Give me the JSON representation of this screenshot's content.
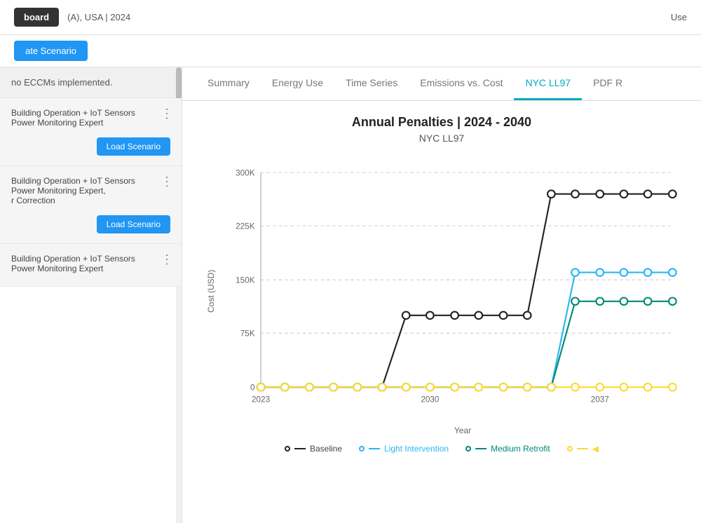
{
  "header": {
    "dashboard_label": "board",
    "location": "(A), USA | 2024",
    "right_text": "Use"
  },
  "sub_header": {
    "create_scenario_btn": "ate Scenario"
  },
  "sidebar": {
    "no_eccm_text": "no ECCMs implemented.",
    "scenarios": [
      {
        "id": 1,
        "title": "Building Operation + IoT Sensors\nPower Monitoring Expert",
        "load_btn": "Load Scenario"
      },
      {
        "id": 2,
        "title": "Building Operation + IoT Sensors\nPower Monitoring Expert,\nr Correction",
        "load_btn": "Load Scenario"
      },
      {
        "id": 3,
        "title": "Building Operation + IoT Sensors\nPower Monitoring Expert",
        "load_btn": "Load Scenario"
      }
    ]
  },
  "tabs": [
    {
      "label": "Summary",
      "active": false
    },
    {
      "label": "Energy Use",
      "active": false
    },
    {
      "label": "Time Series",
      "active": false
    },
    {
      "label": "Emissions vs. Cost",
      "active": false
    },
    {
      "label": "NYC LL97",
      "active": true
    },
    {
      "label": "PDF R",
      "active": false
    }
  ],
  "chart": {
    "title": "Annual Penalties | 2024 - 2040",
    "subtitle": "NYC LL97",
    "y_axis_label": "Cost (USD)",
    "x_axis_label": "Year",
    "y_ticks": [
      "0",
      "75K",
      "150K",
      "225K",
      "300K"
    ],
    "x_ticks": [
      "2023",
      "2030",
      "2037"
    ],
    "legend": [
      {
        "label": "Baseline",
        "color": "#222222",
        "dot_color": "#ffffff",
        "dot_border": "#222222"
      },
      {
        "label": "Light Intervention",
        "color": "#29B6F6",
        "dot_color": "#ffffff",
        "dot_border": "#29B6F6"
      },
      {
        "label": "Medium Retrofit",
        "color": "#00897B",
        "dot_color": "#ffffff",
        "dot_border": "#00897B"
      },
      {
        "label": "",
        "color": "#FDD835",
        "dot_color": "#ffffff",
        "dot_border": "#FDD835"
      }
    ]
  }
}
